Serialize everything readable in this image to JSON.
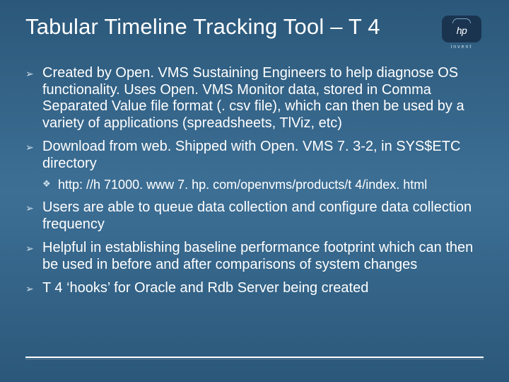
{
  "title": "Tabular Timeline Tracking Tool – T 4",
  "logo": {
    "text": "hp",
    "tagline": "invent"
  },
  "bullets": [
    {
      "text": "Created by Open. VMS Sustaining Engineers to help diagnose OS functionality.  Uses Open. VMS Monitor data, stored in Comma Separated Value file format (. csv file), which can then be used by a variety of applications (spreadsheets, TlViz, etc)"
    },
    {
      "text": "Download from web.  Shipped with Open. VMS 7. 3-2, in SYS$ETC directory",
      "sub": [
        {
          "text": "http: //h 71000. www 7. hp. com/openvms/products/t 4/index. html"
        }
      ]
    },
    {
      "text": "Users are able to queue data collection and configure data collection frequency"
    },
    {
      "text": "Helpful in establishing baseline performance footprint which can then be used in before and after comparisons of system changes"
    },
    {
      "text": "T 4 ‘hooks’ for Oracle and Rdb Server being created"
    }
  ]
}
